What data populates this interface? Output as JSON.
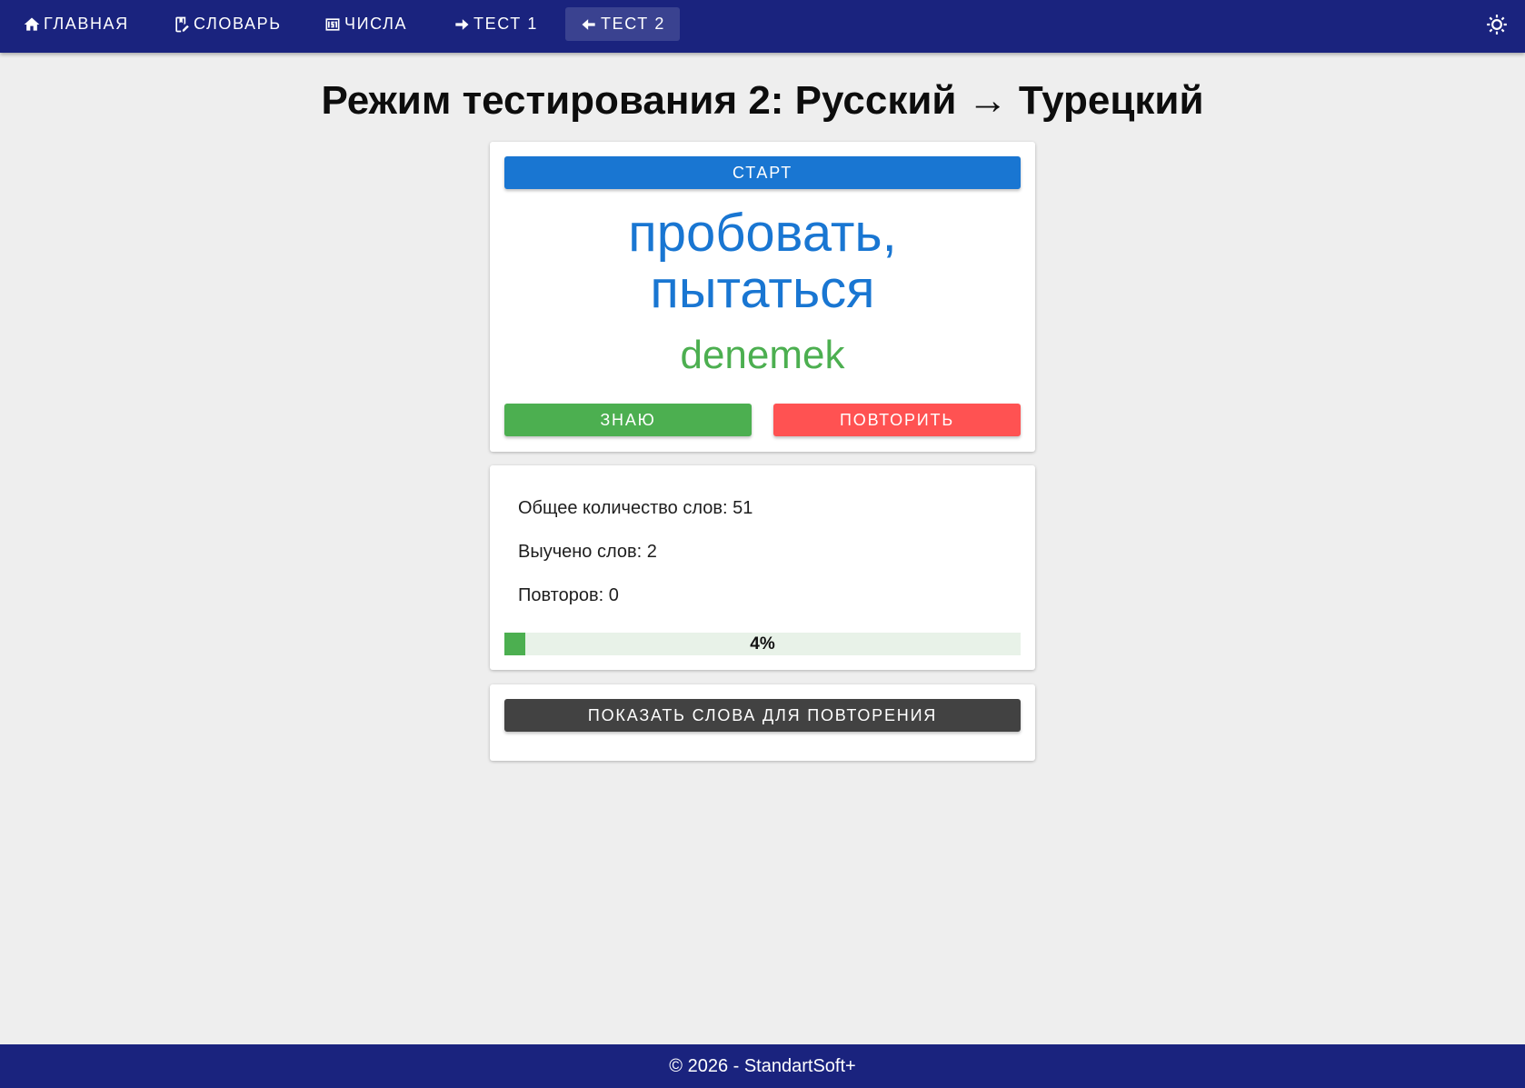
{
  "nav": {
    "items": [
      {
        "label": "ГЛАВНАЯ",
        "icon": "home-icon"
      },
      {
        "label": "СЛОВАРЬ",
        "icon": "book-edit-icon"
      },
      {
        "label": "ЧИСЛА",
        "icon": "numeric-icon"
      },
      {
        "label": "ТЕСТ 1",
        "icon": "arrow-right-icon"
      },
      {
        "label": "ТЕСТ 2",
        "icon": "arrow-left-icon",
        "active": true
      }
    ],
    "theme_icon": "brightness-icon"
  },
  "page": {
    "title": "Режим тестирования 2: Русский → Турецкий"
  },
  "quiz": {
    "start_label": "СТАРТ",
    "word_ru_line1": "пробовать,",
    "word_ru_line2": "пытаться",
    "word_tr": "denemek",
    "know_label": "ЗНАЮ",
    "repeat_label": "ПОВТОРИТЬ"
  },
  "stats": {
    "total": "Общее количество слов: 51",
    "learned": "Выучено слов: 2",
    "repeats": "Повторов: 0",
    "progress_percent": 4,
    "progress_label": "4%"
  },
  "review": {
    "show_label": "ПОКАЗАТЬ СЛОВА ДЛЯ ПОВТОРЕНИЯ"
  },
  "footer": {
    "text": "© 2026 - StandartSoft+"
  },
  "colors": {
    "navbar": "#1a237e",
    "primary": "#1976d2",
    "success": "#4caf50",
    "error": "#ff5252",
    "dark": "#424242",
    "background": "#eeeeee"
  }
}
